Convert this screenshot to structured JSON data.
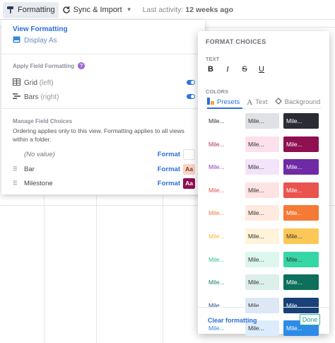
{
  "toolbar": {
    "formatting_label": "Formatting",
    "sync_label": "Sync & Import",
    "last_activity_label": "Last activity:",
    "last_activity_value": "12 weeks ago"
  },
  "left_panel": {
    "view_formatting": "View Formatting",
    "display_as": "Display As",
    "apply_field_formatting": "Apply Field Formatting",
    "help_glyph": "?",
    "grid_label": "Grid",
    "grid_sub": "(left)",
    "bars_label": "Bars",
    "bars_sub": "(right)",
    "manage_field_choices": "Manage Field Choices",
    "description": "Ordering applies only to this view. Formatting applies to all views within a folder.",
    "fields": [
      {
        "name": "(No value)",
        "format": "Format",
        "swatch_text": "",
        "swatch_bg": "#ffffff",
        "swatch_fg": "#333333"
      },
      {
        "name": "Bar",
        "format": "Format",
        "swatch_text": "Aa",
        "swatch_bg": "#fbd3c3",
        "swatch_fg": "#7a3a25"
      },
      {
        "name": "Milestone",
        "format": "Format",
        "swatch_text": "Aa",
        "swatch_bg": "#8e1050",
        "swatch_fg": "#ffffff"
      }
    ]
  },
  "right_panel": {
    "title": "FORMAT CHOICES",
    "text_label": "TEXT",
    "text_tools": [
      "B",
      "I",
      "S",
      "U"
    ],
    "colors_label": "COLORS",
    "tabs": {
      "presets": "Presets",
      "text": "Text",
      "background": "Background"
    },
    "presets": [
      [
        "#333333",
        "#e0e1e4",
        "#333333",
        "#2b2b33",
        "#ffffff"
      ],
      [
        "#b0306a",
        "#fde0ec",
        "#333333",
        "#8e1050",
        "#ffffff"
      ],
      [
        "#9140b6",
        "#f3e3fb",
        "#333333",
        "#6f2aa5",
        "#ffffff"
      ],
      [
        "#e0554e",
        "#fde4e3",
        "#333333",
        "#e9544f",
        "#ffffff"
      ],
      [
        "#f07b3f",
        "#feeadf",
        "#333333",
        "#f47a35",
        "#ffffff"
      ],
      [
        "#f5b83b",
        "#fff3d9",
        "#333333",
        "#fbc756",
        "#333333"
      ],
      [
        "#2fbe97",
        "#dcf7ee",
        "#333333",
        "#36d6a5",
        "#333333"
      ],
      [
        "#177e6a",
        "#dcefeb",
        "#333333",
        "#0d6f5c",
        "#ffffff"
      ],
      [
        "#274d86",
        "#dde8f6",
        "#333333",
        "#174178",
        "#ffffff"
      ],
      [
        "#2b86e0",
        "#ddecfc",
        "#333333",
        "#2e8be8",
        "#ffffff"
      ]
    ],
    "preset_text": "Mile...",
    "clear_formatting": "Clear formatting",
    "done": "Done"
  }
}
